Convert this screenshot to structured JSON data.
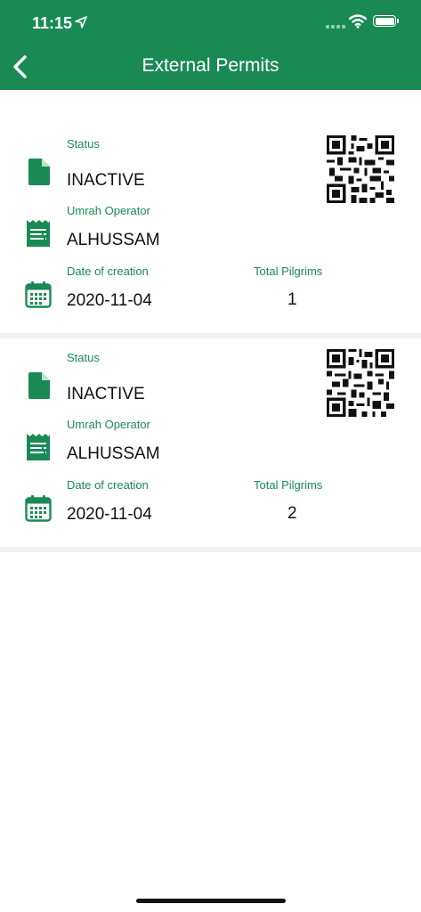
{
  "status_bar": {
    "time": "11:15"
  },
  "header": {
    "title": "External Permits"
  },
  "permits": [
    {
      "status_label": "Status",
      "status": "INACTIVE",
      "operator_label": "Umrah Operator",
      "operator": "ALHUSSAM",
      "date_label": "Date of creation",
      "date": "2020-11-04",
      "pilgrims_label": "Total Pilgrims",
      "pilgrims": "1"
    },
    {
      "status_label": "Status",
      "status": "INACTIVE",
      "operator_label": "Umrah Operator",
      "operator": "ALHUSSAM",
      "date_label": "Date of creation",
      "date": "2020-11-04",
      "pilgrims_label": "Total Pilgrims",
      "pilgrims": "2"
    }
  ],
  "colors": {
    "brand": "#1a8a55",
    "separator": "#f1f1f1"
  },
  "icons": [
    "back-arrow-icon",
    "document-icon",
    "receipt-icon",
    "calendar-icon",
    "qr-code-icon"
  ]
}
